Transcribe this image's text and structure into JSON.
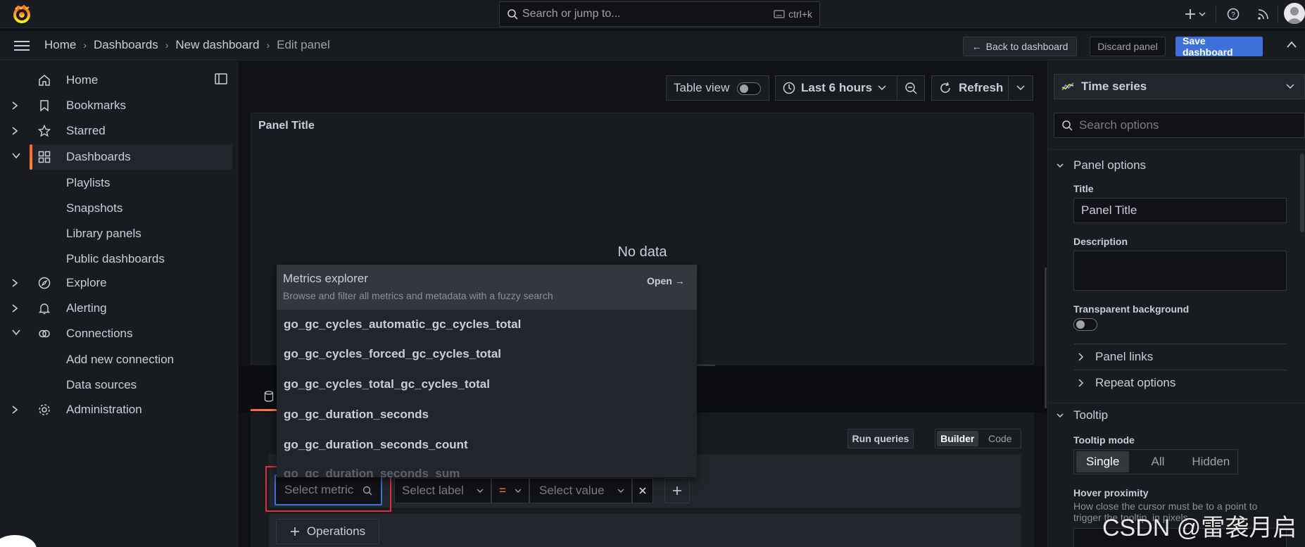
{
  "topbar": {
    "search_placeholder": "Search or jump to...",
    "search_shortcut": "ctrl+k",
    "icons": [
      "grafana-logo",
      "plus-icon",
      "help-icon",
      "rss-icon",
      "avatar"
    ]
  },
  "breadcrumb": {
    "items": [
      "Home",
      "Dashboards",
      "New dashboard"
    ],
    "current": "Edit panel"
  },
  "header_actions": {
    "back": "Back to dashboard",
    "discard": "Discard panel",
    "save": "Save dashboard"
  },
  "sidebar": {
    "items": [
      {
        "label": "Home",
        "icon": "home-icon"
      },
      {
        "label": "Bookmarks",
        "icon": "bookmark-icon"
      },
      {
        "label": "Starred",
        "icon": "star-icon"
      },
      {
        "label": "Dashboards",
        "icon": "apps-icon"
      },
      {
        "label": "Explore",
        "icon": "compass-icon"
      },
      {
        "label": "Alerting",
        "icon": "bell-icon"
      },
      {
        "label": "Connections",
        "icon": "link-icon"
      },
      {
        "label": "Administration",
        "icon": "cog-icon"
      }
    ],
    "dashboards_children": [
      "Playlists",
      "Snapshots",
      "Library panels",
      "Public dashboards"
    ],
    "connections_children": [
      "Add new connection",
      "Data sources"
    ]
  },
  "panel_toolbar": {
    "table_view": "Table view",
    "time_range": "Last 6 hours",
    "refresh": "Refresh"
  },
  "panel": {
    "title": "Panel Title",
    "no_data": "No data"
  },
  "query_editor": {
    "run_queries": "Run queries",
    "mode_builder": "Builder",
    "mode_code": "Code",
    "metric_placeholder": "Select metric",
    "label_placeholder": "Select label",
    "operator": "=",
    "value_placeholder": "Select value",
    "operations": "Operations"
  },
  "metrics_dropdown": {
    "header_title": "Metrics explorer",
    "header_sub": "Browse and filter all metrics and metadata with a fuzzy search",
    "open": "Open",
    "items": [
      "go_gc_cycles_automatic_gc_cycles_total",
      "go_gc_cycles_forced_gc_cycles_total",
      "go_gc_cycles_total_gc_cycles_total",
      "go_gc_duration_seconds",
      "go_gc_duration_seconds_count",
      "go_gc_duration_seconds_sum"
    ]
  },
  "options": {
    "viz": "Time series",
    "search_placeholder": "Search options",
    "panel_options": "Panel options",
    "title_label": "Title",
    "title_value": "Panel Title",
    "description_label": "Description",
    "transparent_label": "Transparent background",
    "panel_links": "Panel links",
    "repeat_options": "Repeat options",
    "tooltip": "Tooltip",
    "tooltip_mode_label": "Tooltip mode",
    "tooltip_modes": [
      "Single",
      "All",
      "Hidden"
    ],
    "tooltip_mode_selected": "Single",
    "hover_label": "Hover proximity",
    "hover_desc": "How close the cursor must be to a point to trigger the tooltip, in pixels"
  },
  "watermark": "CSDN @雷袭月启",
  "colors": {
    "accent_blue": "#3d71d9",
    "highlight_red": "#e02f44",
    "orange": "#ff8833",
    "background": "#111217"
  }
}
